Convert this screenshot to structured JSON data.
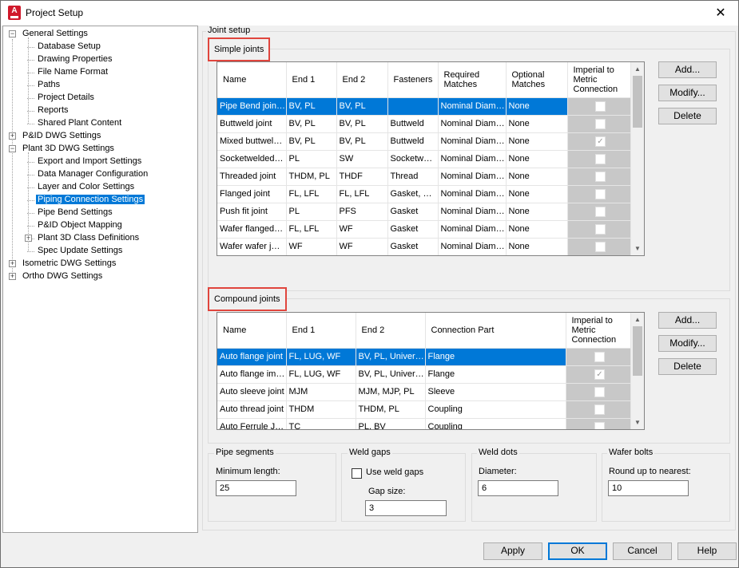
{
  "window": {
    "title": "Project Setup",
    "close_glyph": "✕"
  },
  "tree": {
    "items": [
      {
        "label": "General Settings",
        "level": 0,
        "expander": "−"
      },
      {
        "label": "Database Setup",
        "level": 1
      },
      {
        "label": "Drawing Properties",
        "level": 1
      },
      {
        "label": "File Name Format",
        "level": 1
      },
      {
        "label": "Paths",
        "level": 1
      },
      {
        "label": "Project Details",
        "level": 1
      },
      {
        "label": "Reports",
        "level": 1
      },
      {
        "label": "Shared Plant Content",
        "level": 1
      },
      {
        "label": "P&ID DWG Settings",
        "level": 0,
        "expander": "+"
      },
      {
        "label": "Plant 3D DWG Settings",
        "level": 0,
        "expander": "−"
      },
      {
        "label": "Export and Import Settings",
        "level": 1
      },
      {
        "label": "Data Manager Configuration",
        "level": 1
      },
      {
        "label": "Layer and Color Settings",
        "level": 1
      },
      {
        "label": "Piping Connection Settings",
        "level": 1,
        "selected": true
      },
      {
        "label": "Pipe Bend Settings",
        "level": 1
      },
      {
        "label": "P&ID Object Mapping",
        "level": 1
      },
      {
        "label": "Plant 3D Class Definitions",
        "level": 1,
        "expander": "+"
      },
      {
        "label": "Spec Update Settings",
        "level": 1
      },
      {
        "label": "Isometric DWG Settings",
        "level": 0,
        "expander": "+"
      },
      {
        "label": "Ortho DWG Settings",
        "level": 0,
        "expander": "+"
      }
    ]
  },
  "joint_setup": {
    "title": "Joint setup"
  },
  "simple_joints": {
    "title": "Simple joints",
    "columns": [
      "Name",
      "End 1",
      "End 2",
      "Fasteners",
      "Required Matches",
      "Optional Matches",
      "Imperial to Metric Connection"
    ],
    "rows": [
      {
        "cells": [
          "Pipe Bend join…",
          "BV, PL",
          "BV, PL",
          "",
          "Nominal Diam…",
          "None"
        ],
        "checked": false,
        "selected": true
      },
      {
        "cells": [
          "Buttweld joint",
          "BV, PL",
          "BV, PL",
          "Buttweld",
          "Nominal Diam…",
          "None"
        ],
        "checked": false
      },
      {
        "cells": [
          "Mixed buttwel…",
          "BV, PL",
          "BV, PL",
          "Buttweld",
          "Nominal Diam…",
          "None"
        ],
        "checked": true
      },
      {
        "cells": [
          "Socketwelded…",
          "PL",
          "SW",
          "Socketw…",
          "Nominal Diam…",
          "None"
        ],
        "checked": false
      },
      {
        "cells": [
          "Threaded joint",
          "THDM, PL",
          "THDF",
          "Thread",
          "Nominal Diam…",
          "None"
        ],
        "checked": false
      },
      {
        "cells": [
          "Flanged joint",
          "FL, LFL",
          "FL, LFL",
          "Gasket, …",
          "Nominal Diam…",
          "None"
        ],
        "checked": false
      },
      {
        "cells": [
          "Push fit joint",
          "PL",
          "PFS",
          "Gasket",
          "Nominal Diam…",
          "None"
        ],
        "checked": false
      },
      {
        "cells": [
          "Wafer flanged…",
          "FL, LFL",
          "WF",
          "Gasket",
          "Nominal Diam…",
          "None"
        ],
        "checked": false
      },
      {
        "cells": [
          "Wafer wafer j…",
          "WF",
          "WF",
          "Gasket",
          "Nominal Diam…",
          "None"
        ],
        "checked": false
      }
    ],
    "buttons": {
      "add": "Add...",
      "modify": "Modify...",
      "delete": "Delete"
    }
  },
  "compound_joints": {
    "title": "Compound joints",
    "columns": [
      "Name",
      "End 1",
      "End 2",
      "Connection Part",
      "Imperial to Metric Connection"
    ],
    "rows": [
      {
        "cells": [
          "Auto flange joint",
          "FL, LUG, WF",
          "BV, PL, Univer…",
          "Flange"
        ],
        "checked": false,
        "selected": true
      },
      {
        "cells": [
          "Auto flange im…",
          "FL, LUG, WF",
          "BV, PL, Univer…",
          "Flange"
        ],
        "checked": true
      },
      {
        "cells": [
          "Auto sleeve joint",
          "MJM",
          "MJM, MJP, PL",
          "Sleeve"
        ],
        "checked": false
      },
      {
        "cells": [
          "Auto thread joint",
          "THDM",
          "THDM, PL",
          "Coupling"
        ],
        "checked": false
      },
      {
        "cells": [
          "Auto Ferrule J…",
          "TC",
          "PL, BV",
          "Coupling"
        ],
        "checked": false
      }
    ],
    "buttons": {
      "add": "Add...",
      "modify": "Modify...",
      "delete": "Delete"
    }
  },
  "pipe_segments": {
    "title": "Pipe segments",
    "label": "Minimum length:",
    "value": "25"
  },
  "weld_gaps": {
    "title": "Weld gaps",
    "checkbox_label": "Use weld gaps",
    "gap_label": "Gap size:",
    "value": "3"
  },
  "weld_dots": {
    "title": "Weld dots",
    "label": "Diameter:",
    "value": "6"
  },
  "wafer_bolts": {
    "title": "Wafer bolts",
    "label": "Round up to nearest:",
    "value": "10"
  },
  "footer": {
    "apply": "Apply",
    "ok": "OK",
    "cancel": "Cancel",
    "help": "Help"
  },
  "colors": {
    "selection": "#0078d7",
    "highlight_border": "#e0453d",
    "app_icon": "#d0192b"
  }
}
